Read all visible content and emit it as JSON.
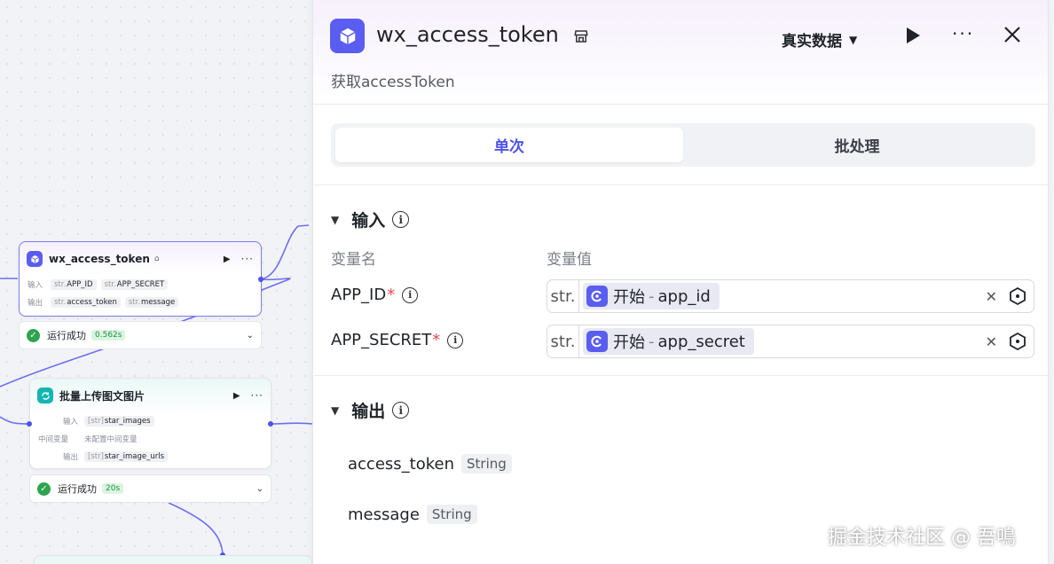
{
  "panel": {
    "title": "wx_access_token",
    "subtitle": "获取accessToken",
    "data_mode": "真实数据",
    "tabs": [
      {
        "label": "单次",
        "active": true
      },
      {
        "label": "批处理",
        "active": false
      }
    ],
    "input_section": {
      "title": "输入",
      "col_name": "变量名",
      "col_value": "变量值",
      "rows": [
        {
          "name": "APP_ID",
          "required": "*",
          "type": "str.",
          "ref_node": "开始",
          "sep": "-",
          "ref_var": "app_id"
        },
        {
          "name": "APP_SECRET",
          "required": "*",
          "type": "str.",
          "ref_node": "开始",
          "sep": "-",
          "ref_var": "app_secret"
        }
      ]
    },
    "output_section": {
      "title": "输出",
      "rows": [
        {
          "name": "access_token",
          "type": "String"
        },
        {
          "name": "message",
          "type": "String"
        }
      ]
    }
  },
  "canvas": {
    "node1": {
      "title": "wx_access_token",
      "input_label": "输入",
      "inputs": [
        {
          "type": "str.",
          "name": "APP_ID"
        },
        {
          "type": "str.",
          "name": "APP_SECRET"
        }
      ],
      "output_label": "输出",
      "outputs": [
        {
          "type": "str.",
          "name": "access_token"
        },
        {
          "type": "str.",
          "name": "message"
        }
      ],
      "status": "运行成功",
      "time": "0.562s"
    },
    "node2": {
      "title": "批量上传图文图片",
      "input_label": "输入",
      "input": {
        "type": "[str]",
        "name": "star_images"
      },
      "mid_label": "中间变量",
      "mid_value": "未配置中间变量",
      "output_label": "输出",
      "output": {
        "type": "[str]",
        "name": "star_image_urls"
      },
      "status": "运行成功",
      "time": "20s"
    }
  },
  "watermark": "掘金技术社区 @ 吾鳴",
  "colors": {
    "accent": "#4d53e8",
    "success": "#2ea44f",
    "required": "#e5484d",
    "node_icon": "#5a5df0",
    "loop_icon": "#13b5b1"
  }
}
